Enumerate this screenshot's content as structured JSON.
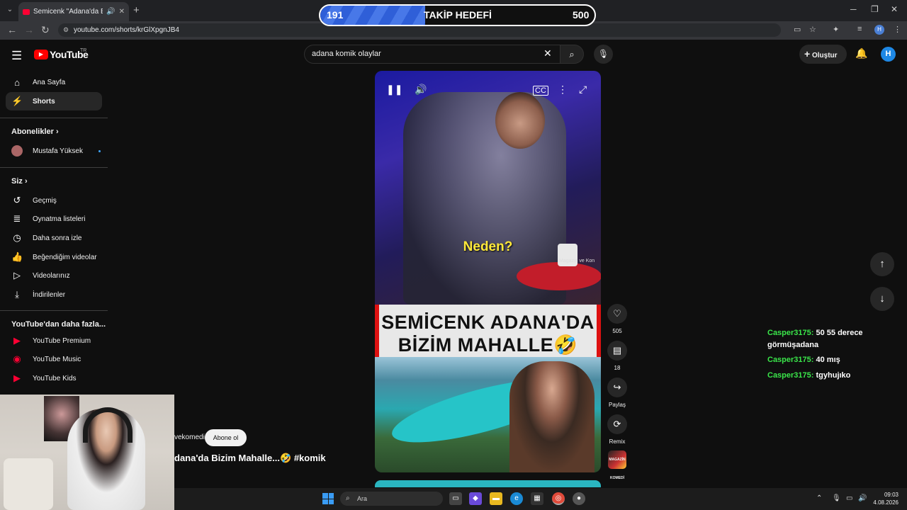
{
  "browser": {
    "tab_title": "Semicenk \"Adana'da Bizim",
    "url": "youtube.com/shorts/krGlXpgnJB4"
  },
  "overlay_goal": {
    "current": "191",
    "label": "TAKİP HEDEFİ",
    "target": "500",
    "progress_fraction": 0.382
  },
  "youtube": {
    "logo_text": "YouTube",
    "country_code": "TR",
    "search_value": "adana komik olaylar",
    "create_label": "Oluştur",
    "avatar_letter": "H"
  },
  "sidebar": {
    "main": [
      {
        "label": "Ana Sayfa",
        "icon": "home-icon"
      },
      {
        "label": "Shorts",
        "icon": "shorts-icon"
      }
    ],
    "subscriptions_header": "Abonelikler",
    "subscriptions": [
      {
        "label": "Mustafa Yüksek"
      }
    ],
    "you_header": "Siz",
    "you_items": [
      {
        "label": "Geçmiş",
        "icon": "history-icon"
      },
      {
        "label": "Oynatma listeleri",
        "icon": "playlist-icon"
      },
      {
        "label": "Daha sonra izle",
        "icon": "clock-icon"
      },
      {
        "label": "Beğendiğim videolar",
        "icon": "thumbs-up-icon"
      },
      {
        "label": "Videolarınız",
        "icon": "video-icon"
      },
      {
        "label": "İndirilenler",
        "icon": "download-icon"
      }
    ],
    "more_header": "YouTube'dan daha fazla...",
    "more_items": [
      {
        "label": "YouTube Premium"
      },
      {
        "label": "YouTube Music"
      },
      {
        "label": "YouTube Kids"
      }
    ]
  },
  "short": {
    "caption_top": "Neden?",
    "watermark": "Magazin ve Kon",
    "banner_line1": "SEMİCENK ADANA'DA",
    "banner_line2": "BİZİM MAHALLE🤣",
    "channel_partial": "vekomedi",
    "subscribe_label": "Abone ol",
    "title_partial": "dana'da Bizim Mahalle...🤣 #komik",
    "likes": "505",
    "comments": "18",
    "share_label": "Paylaş",
    "remix_label": "Remix",
    "channel_thumb_text": "MAGAZİN KOMEDİ"
  },
  "chat": [
    {
      "user": "Casper3175:",
      "message": "50 55 derece görmüşadana"
    },
    {
      "user": "Casper3175:",
      "message": "40 mış"
    },
    {
      "user": "Casper3175:",
      "message": "tgyhujıko"
    }
  ],
  "taskbar": {
    "search_placeholder": "Ara",
    "time": "09:03",
    "date": "4.08.2026"
  }
}
